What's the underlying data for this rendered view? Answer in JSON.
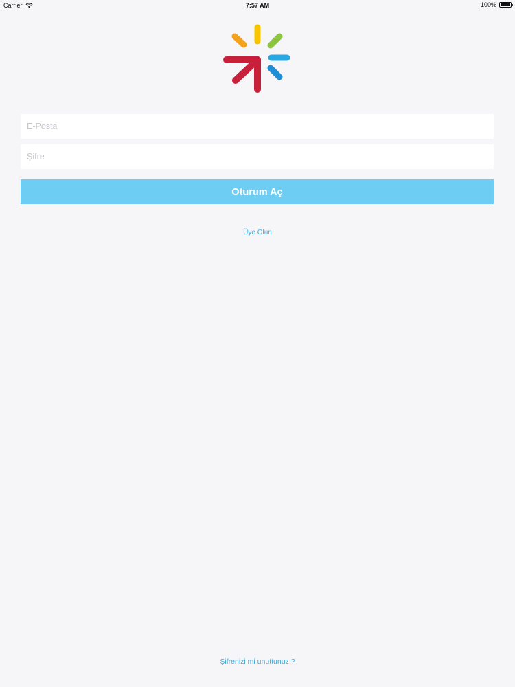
{
  "status_bar": {
    "carrier": "Carrier",
    "time": "7:57 AM",
    "battery": "100%",
    "battery_level": 1.0
  },
  "logo": {
    "colors": {
      "arrow": "#c8203a",
      "top_left": "#f3a01c",
      "top": "#f6c500",
      "top_right": "#8bc43f",
      "right": "#2aa8e2",
      "bottom_right": "#1f8ed6"
    }
  },
  "login_form": {
    "email_placeholder": "E-Posta",
    "email_value": "",
    "password_placeholder": "Şifre",
    "password_value": "",
    "submit_label": "Oturum Aç"
  },
  "links": {
    "register": "Üye Olun",
    "forgot_password": "Şifrenizi mi unuttunuz ?"
  },
  "colors": {
    "background": "#f6f5f7",
    "button": "#6dcdf3",
    "link": "#33b0e5"
  },
  "icons": {
    "wifi": "wifi-icon",
    "battery": "battery-icon",
    "logo": "logo-icon"
  }
}
